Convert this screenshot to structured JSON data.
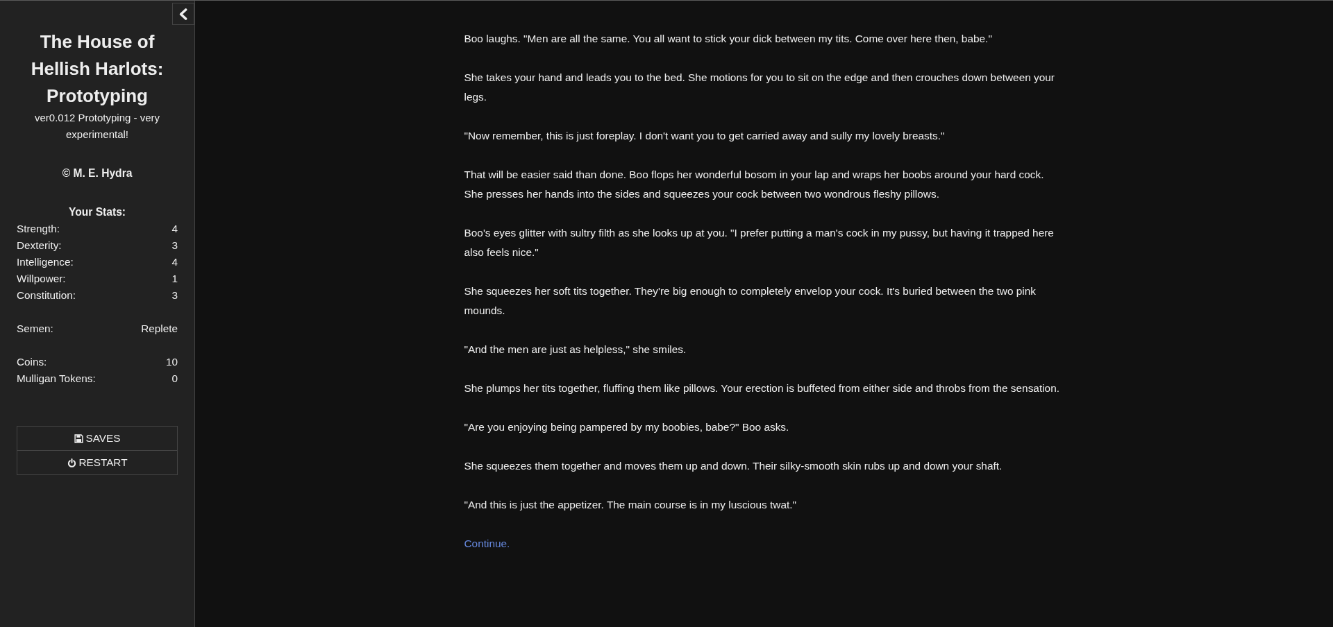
{
  "sidebar": {
    "title": "The House of Hellish Harlots: Prototyping",
    "subtitle": "ver0.012 Prototyping - very experimental!",
    "author": "© M. E. Hydra",
    "stats_heading": "Your Stats:",
    "stat_groups": [
      [
        {
          "label": "Strength:",
          "value": "4"
        },
        {
          "label": "Dexterity:",
          "value": "3"
        },
        {
          "label": "Intelligence:",
          "value": "4"
        },
        {
          "label": "Willpower:",
          "value": "1"
        },
        {
          "label": "Constitution:",
          "value": "3"
        }
      ],
      [
        {
          "label": "Semen:",
          "value": "Replete"
        }
      ],
      [
        {
          "label": "Coins:",
          "value": "10"
        },
        {
          "label": "Mulligan Tokens:",
          "value": "0"
        }
      ]
    ],
    "menu": [
      {
        "label": "SAVES",
        "kind": "saves"
      },
      {
        "label": "RESTART",
        "kind": "restart"
      }
    ]
  },
  "passage": {
    "paragraphs": [
      "Boo laughs. \"Men are all the same. You all want to stick your dick between my tits. Come over here then, babe.\"",
      "She takes your hand and leads you to the bed. She motions for you to sit on the edge and then crouches down between your legs.",
      "\"Now remember, this is just foreplay. I don't want you to get carried away and sully my lovely breasts.\"",
      "That will be easier said than done. Boo flops her wonderful bosom in your lap and wraps her boobs around your hard cock. She presses her hands into the sides and squeezes your cock between two wondrous fleshy pillows.",
      "Boo's eyes glitter with sultry filth as she looks up at you. \"I prefer putting a man's cock in my pussy, but having it trapped here also feels nice.\"",
      "She squeezes her soft tits together. They're big enough to completely envelop your cock. It's buried between the two pink mounds.",
      "\"And the men are just as helpless,\" she smiles.",
      "She plumps her tits together, fluffing them like pillows. Your erection is buffeted from either side and throbs from the sensation.",
      "\"Are you enjoying being pampered by my boobies, babe?\" Boo asks.",
      "She squeezes them together and moves them up and down. Their silky-smooth skin rubs up and down your shaft.",
      "\"And this is just the appetizer. The main course is in my luscious twat.\""
    ],
    "link": "Continue."
  }
}
